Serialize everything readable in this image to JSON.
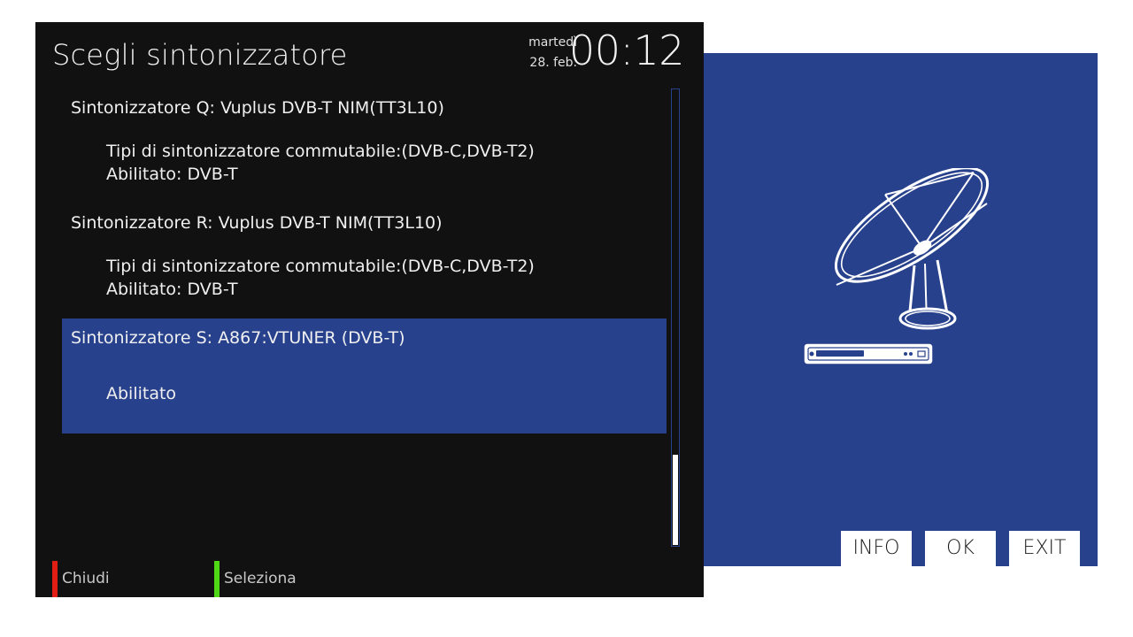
{
  "header": {
    "title": "Scegli sintonizzatore",
    "weekday": "martedì",
    "date": "28. feb.",
    "time": "00:12"
  },
  "tuners": [
    {
      "name": "Sintonizzatore Q: Vuplus DVB-T NIM(TT3L10)",
      "line1": "Tipi di sintonizzatore commutabile:(DVB-C,DVB-T2)",
      "line2": "Abilitato: DVB-T"
    },
    {
      "name": "Sintonizzatore R: Vuplus DVB-T NIM(TT3L10)",
      "line1": "Tipi di sintonizzatore commutabile:(DVB-C,DVB-T2)",
      "line2": "Abilitato: DVB-T"
    },
    {
      "name": "Sintonizzatore S: A867:VTUNER (DVB-T)",
      "line1": "Abilitato",
      "selected": true
    }
  ],
  "scrollbar": {
    "position_fraction": 0.8
  },
  "footer": {
    "red_label": "Chiudi",
    "green_label": "Seleziona",
    "red_color": "#e01e14",
    "green_color": "#4fd814"
  },
  "side": {
    "illustration_icon": "satellite-dish-receiver-icon",
    "buttons": {
      "info": "INFO",
      "ok": "OK",
      "exit": "EXIT"
    }
  },
  "colors": {
    "panel_bg": "#111111",
    "accent": "#27418c",
    "text": "#f0f0f0"
  }
}
